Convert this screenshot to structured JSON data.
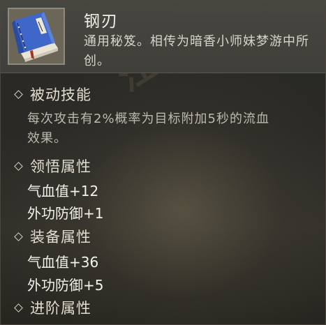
{
  "item": {
    "name": "钢刃",
    "description": "通用秘笈。相传为暗香小师妹梦游中所创。",
    "icon": "blue-book-icon"
  },
  "sections": {
    "passive": {
      "title": "被动技能",
      "lines": [
        "每次攻击有2%概率为目标附加5秒的流血",
        "效果。"
      ]
    },
    "comprehension": {
      "title": "领悟属性",
      "stats": [
        "气血值+12",
        "外功防御+1"
      ]
    },
    "equipment": {
      "title": "装备属性",
      "stats": [
        "气血值+36",
        "外功防御+5"
      ]
    },
    "advanced": {
      "title": "进阶属性"
    }
  },
  "colors": {
    "header_bg": "#444340",
    "panel_bg": "#2b2a27",
    "title_text": "#f2efe6",
    "body_text": "#bdb9ae",
    "book_blue": "#3f67c9"
  }
}
